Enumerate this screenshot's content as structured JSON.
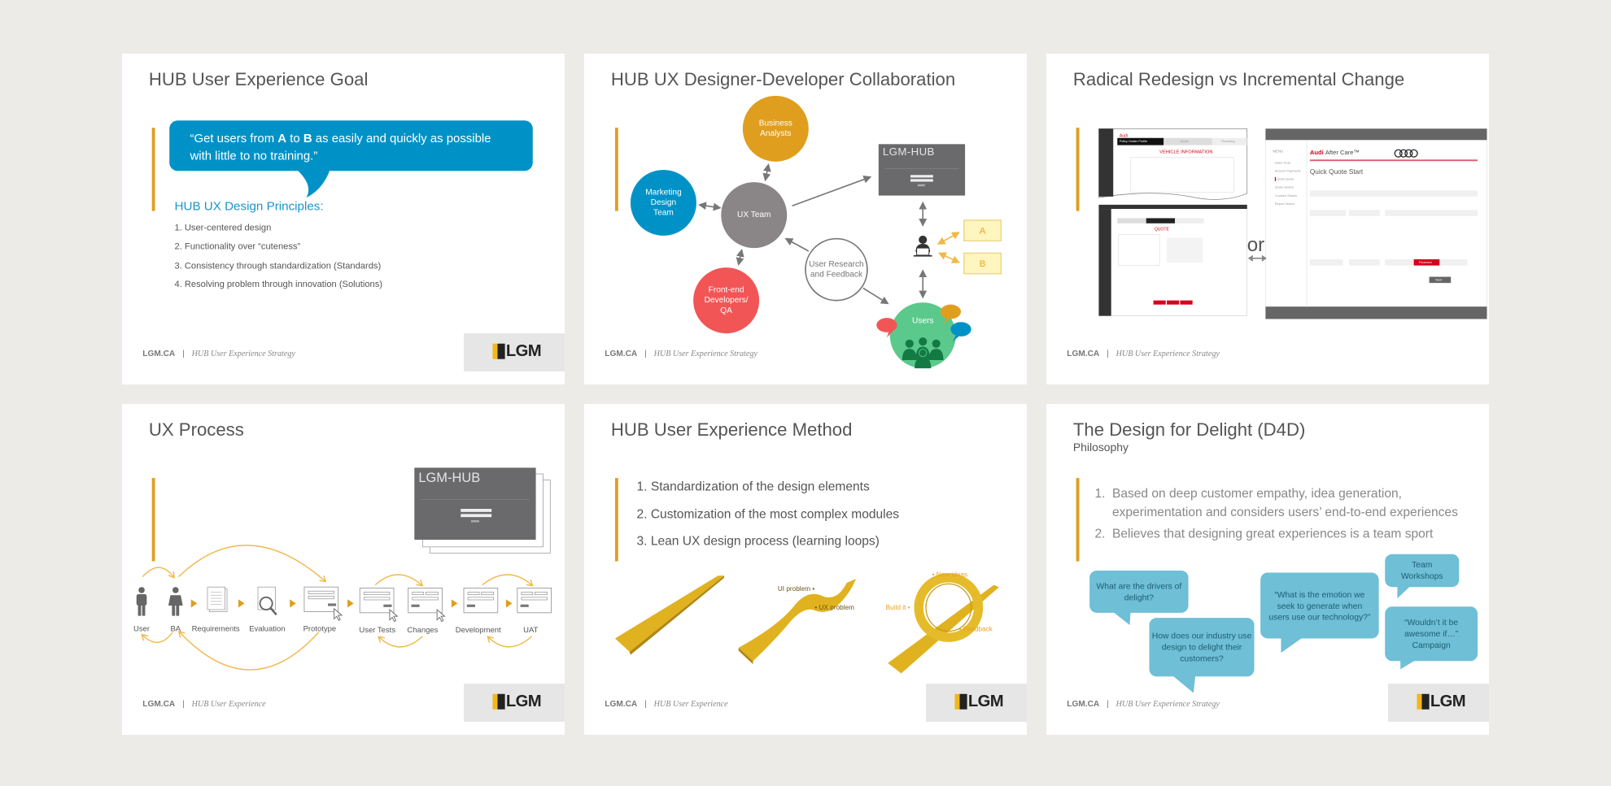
{
  "colors": {
    "accent_bar": "#e09e1f",
    "quote_blue": "#0092c7",
    "bubble_teal": "#6fbfd6",
    "ba": "#e09e1f",
    "marketing": "#0092c7",
    "ux": "#8a8586",
    "frontend": "#f25556",
    "users": "#5bc98c",
    "ribbon": "#e0b21f"
  },
  "footer": {
    "site": "LGM.CA",
    "separator": "|",
    "strategy": "HUB User Experience Strategy",
    "experience": "HUB User Experience"
  },
  "logo": {
    "text": "LGM"
  },
  "slide1": {
    "title": "HUB User Experience Goal",
    "quote_line1_a": "“Get users from ",
    "quote_A": "A",
    "quote_to": " to ",
    "quote_B": "B",
    "quote_line1_b": " as easily and quickly as possible",
    "quote_line2": "with little to no training.”",
    "principles_heading": "HUB UX Design Principles:",
    "principles": [
      "1. User-centered design",
      "2. Functionality over “cuteness”",
      "3. Consistency through standardization (Standards)",
      "4. Resolving problem through innovation (Solutions)"
    ]
  },
  "slide2": {
    "title": "HUB UX Designer-Developer Collaboration",
    "business_analysts": "Business Analysts",
    "marketing": "Marketing Design Team",
    "ux_team": "UX Team",
    "frontend": "Front-end Developers/ QA",
    "research": "User Research and Feedback",
    "users": "Users",
    "screen_logo": "LGM-HUB",
    "option_a": "A",
    "option_b": "B"
  },
  "slide3": {
    "title": "Radical Redesign vs Incremental Change",
    "or": "or",
    "old_screen": {
      "brand": "Audi",
      "tabs": [
        "Policy Holder Profile",
        "Quote",
        "Financing"
      ],
      "heading": "VEHICLE INFORMATION",
      "quote": "QUOTE"
    },
    "new_screen": {
      "brand": "Audi",
      "product": "After Care™",
      "menu": "MENU",
      "menu_items": [
        "Sales Tools",
        "Account Payments",
        "Quick Quote",
        "Quote Search",
        "Contract Search",
        "Report Search"
      ],
      "heading": "Quick Quote Start",
      "financed": "Financed",
      "next": "Next"
    }
  },
  "slide4": {
    "title": "UX Process",
    "screen_logo": "LGM-HUB",
    "steps": [
      "User",
      "BA",
      "Requirements",
      "Evaluation",
      "Prototype",
      "User Tests",
      "Changes",
      "Development",
      "UAT"
    ]
  },
  "slide5": {
    "title": "HUB User Experience Method",
    "items": [
      "1. Standardization of the design elements",
      "2. Customization of the most complex modules",
      "3. Lean UX design process (learning loops)"
    ],
    "labels": {
      "ui_problem": "UI problem •",
      "ux_problem": "• UX problem",
      "new_ideas": "• New ideas",
      "build_it": "Build it •",
      "feedback": "• Feedback"
    }
  },
  "slide6": {
    "title": "The Design for Delight (D4D)",
    "subtitle": "Philosophy",
    "items": [
      {
        "num": "1.",
        "line1": "Based on deep customer empathy, idea generation,",
        "line2": "experimentation and considers users’ end-to-end experiences"
      },
      {
        "num": "2.",
        "line1": "Believes that designing great experiences is a team sport"
      }
    ],
    "bubbles": [
      "What are the drivers of delight?",
      "How does our industry use design to delight their customers?",
      "“What is the emotion we seek to generate when users use our technology?”",
      "Team Workshops",
      "“Wouldn’t it be awesome if…” Campaign"
    ]
  }
}
